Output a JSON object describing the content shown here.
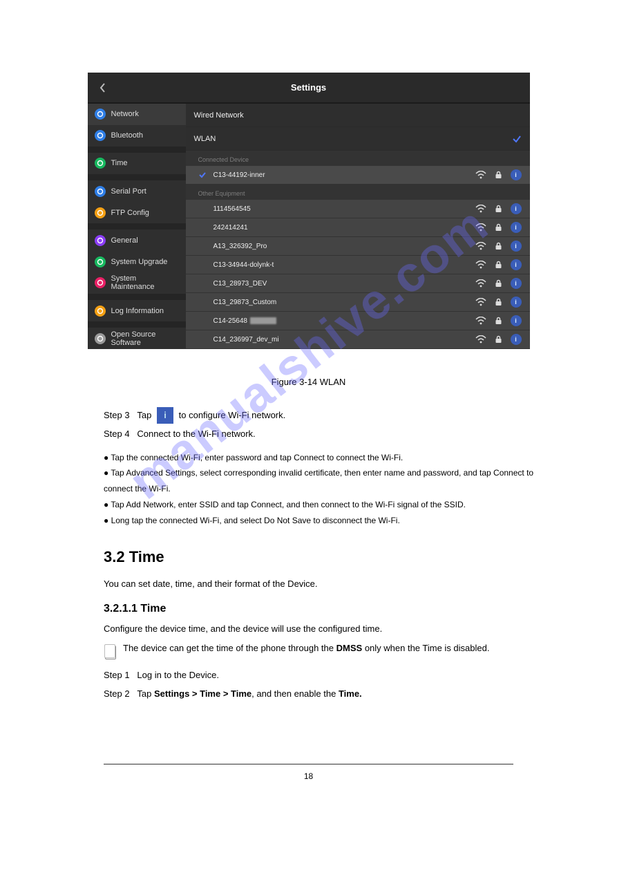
{
  "shot": {
    "title": "Settings",
    "sidebar": [
      {
        "label": "Network",
        "color": "#2f7ee6",
        "glyph": "globe"
      },
      {
        "label": "Bluetooth",
        "color": "#2f7ee6",
        "glyph": "bt"
      },
      {
        "divider": true
      },
      {
        "label": "Time",
        "color": "#18b85f",
        "glyph": "clock"
      },
      {
        "divider": true
      },
      {
        "label": "Serial Port",
        "color": "#2f7ee6",
        "glyph": "port"
      },
      {
        "label": "FTP Config",
        "color": "#f4a014",
        "glyph": "ftp"
      },
      {
        "divider": true
      },
      {
        "label": "General",
        "color": "#8a3df5",
        "glyph": "gen"
      },
      {
        "label": "System Upgrade",
        "color": "#18b85f",
        "glyph": "up"
      },
      {
        "label": "System Maintenance",
        "color": "#e92065",
        "glyph": "maint"
      },
      {
        "divider": true
      },
      {
        "label": "Log Information",
        "color": "#f4a014",
        "glyph": "log"
      },
      {
        "divider": true
      },
      {
        "label": "Open Source Software",
        "color": "#9a9a9a",
        "glyph": "oss"
      }
    ],
    "top_options": [
      {
        "label": "Wired Network",
        "checked": false
      },
      {
        "label": "WLAN",
        "checked": true
      }
    ],
    "connected_label": "Connected Device",
    "other_label": "Other Equipment",
    "connected": [
      {
        "name": "C13-44192-inner"
      }
    ],
    "other": [
      {
        "name": "1114564545"
      },
      {
        "name": "242414241"
      },
      {
        "name": "A13_326392_Pro"
      },
      {
        "name": "C13-34944-dolynk-t"
      },
      {
        "name": "C13_28973_DEV"
      },
      {
        "name": "C13_29873_Custom"
      },
      {
        "name": "C14-25648",
        "redacted": true
      },
      {
        "name": "C14_236997_dev_mi"
      }
    ]
  },
  "page": {
    "figure_caption": "Figure 3-14 WLAN",
    "step3_pre": "Step 3   Tap",
    "step3_post": "to configure Wi-Fi network.",
    "step4_label": "Step 4   Connect to the Wi-Fi network.",
    "note_lines": [
      "●    Tap the connected Wi-Fi, enter password and tap Connect to connect the Wi-Fi.",
      "●    Tap Advanced Settings, select corresponding invalid certificate, then enter name and password, and tap Connect to connect the Wi-Fi.",
      "●    Tap Add Network, enter SSID and tap Connect, and then connect to the Wi-Fi signal of the SSID.",
      "●    Long tap the connected Wi-Fi, and select Do Not Save to disconnect the Wi-Fi."
    ],
    "h1": "3.2 Time",
    "h1_sub": "You can set date, time, and their format of the Device.",
    "h2": "3.2.1.1 Time",
    "p": "Configure the device time, and the device will use the configured time.",
    "note_text": "The device can get the time of the phone through the",
    "note_bold": "DMSS",
    "note_tail": "only when the Time is disabled.",
    "step1": "Step 1   Log in to the Device.",
    "step2_pre": "Step 2   Tap",
    "step2_mid": "Settings > Time > Time",
    "step2_post": ", and then enable the",
    "step2_bold": "Time.",
    "watermark": "manualshive.com",
    "page_number": "18"
  }
}
